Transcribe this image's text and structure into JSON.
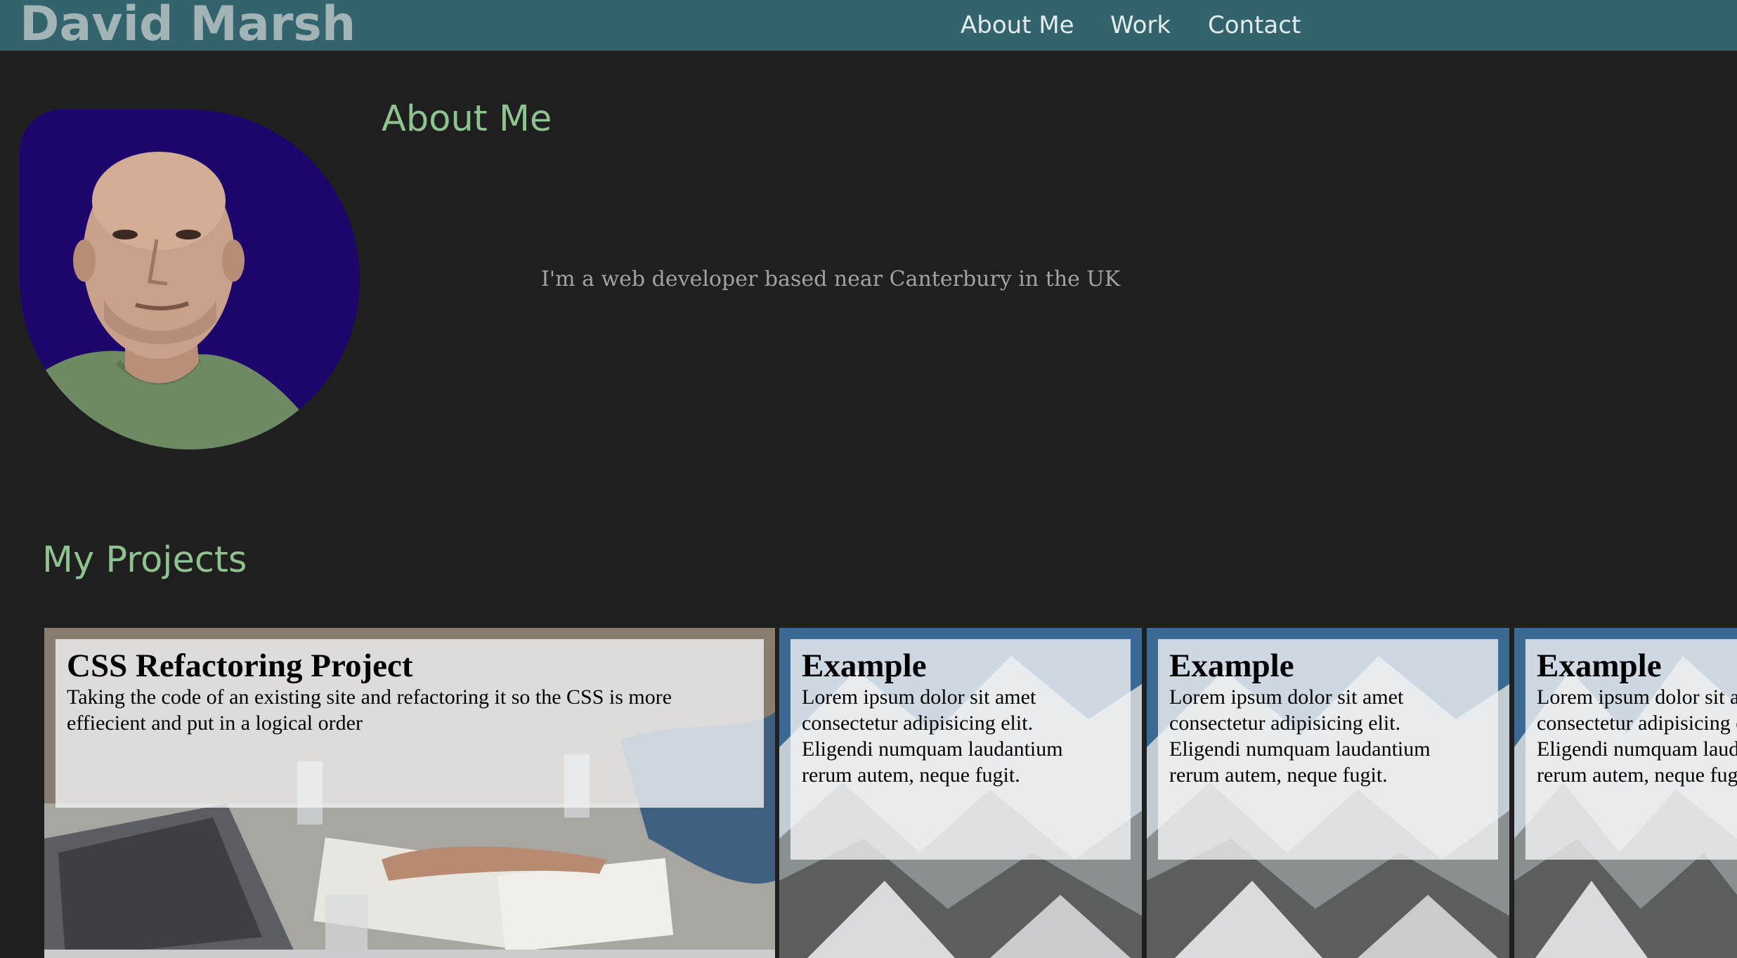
{
  "header": {
    "brand": "David Marsh",
    "nav": [
      {
        "label": "About Me"
      },
      {
        "label": "Work"
      },
      {
        "label": "Contact"
      }
    ],
    "background_color": "#33636c"
  },
  "about": {
    "title": "About Me",
    "text": "I'm a web developer based near Canterbury in the UK"
  },
  "projects": {
    "title": "My Projects",
    "cards": [
      {
        "title": "CSS Refactoring Project",
        "description": "Taking the code of an existing site and refactoring it so the CSS is more effiecient and put in a logical order",
        "image": "office-meeting"
      },
      {
        "title": "Example",
        "description": "Lorem ipsum dolor sit amet\nconsectetur adipisicing elit.\nEligendi numquam laudantium\nrerum autem, neque fugit.",
        "image": "snowy-mountains"
      },
      {
        "title": "Example",
        "description": "Lorem ipsum dolor sit amet\nconsectetur adipisicing elit.\nEligendi numquam laudantium\nrerum autem, neque fugit.",
        "image": "snowy-mountains"
      },
      {
        "title": "Example",
        "description": "Lorem ipsum dolor sit amet\nconsectetur adipisicing elit.\nEligendi numquam laudantium\nrerum autem, neque fugit.",
        "image": "snowy-mountains"
      }
    ]
  },
  "colors": {
    "page_background": "#1f1f1f",
    "heading_green": "#8ec38f",
    "avatar_background": "#1d066b"
  }
}
